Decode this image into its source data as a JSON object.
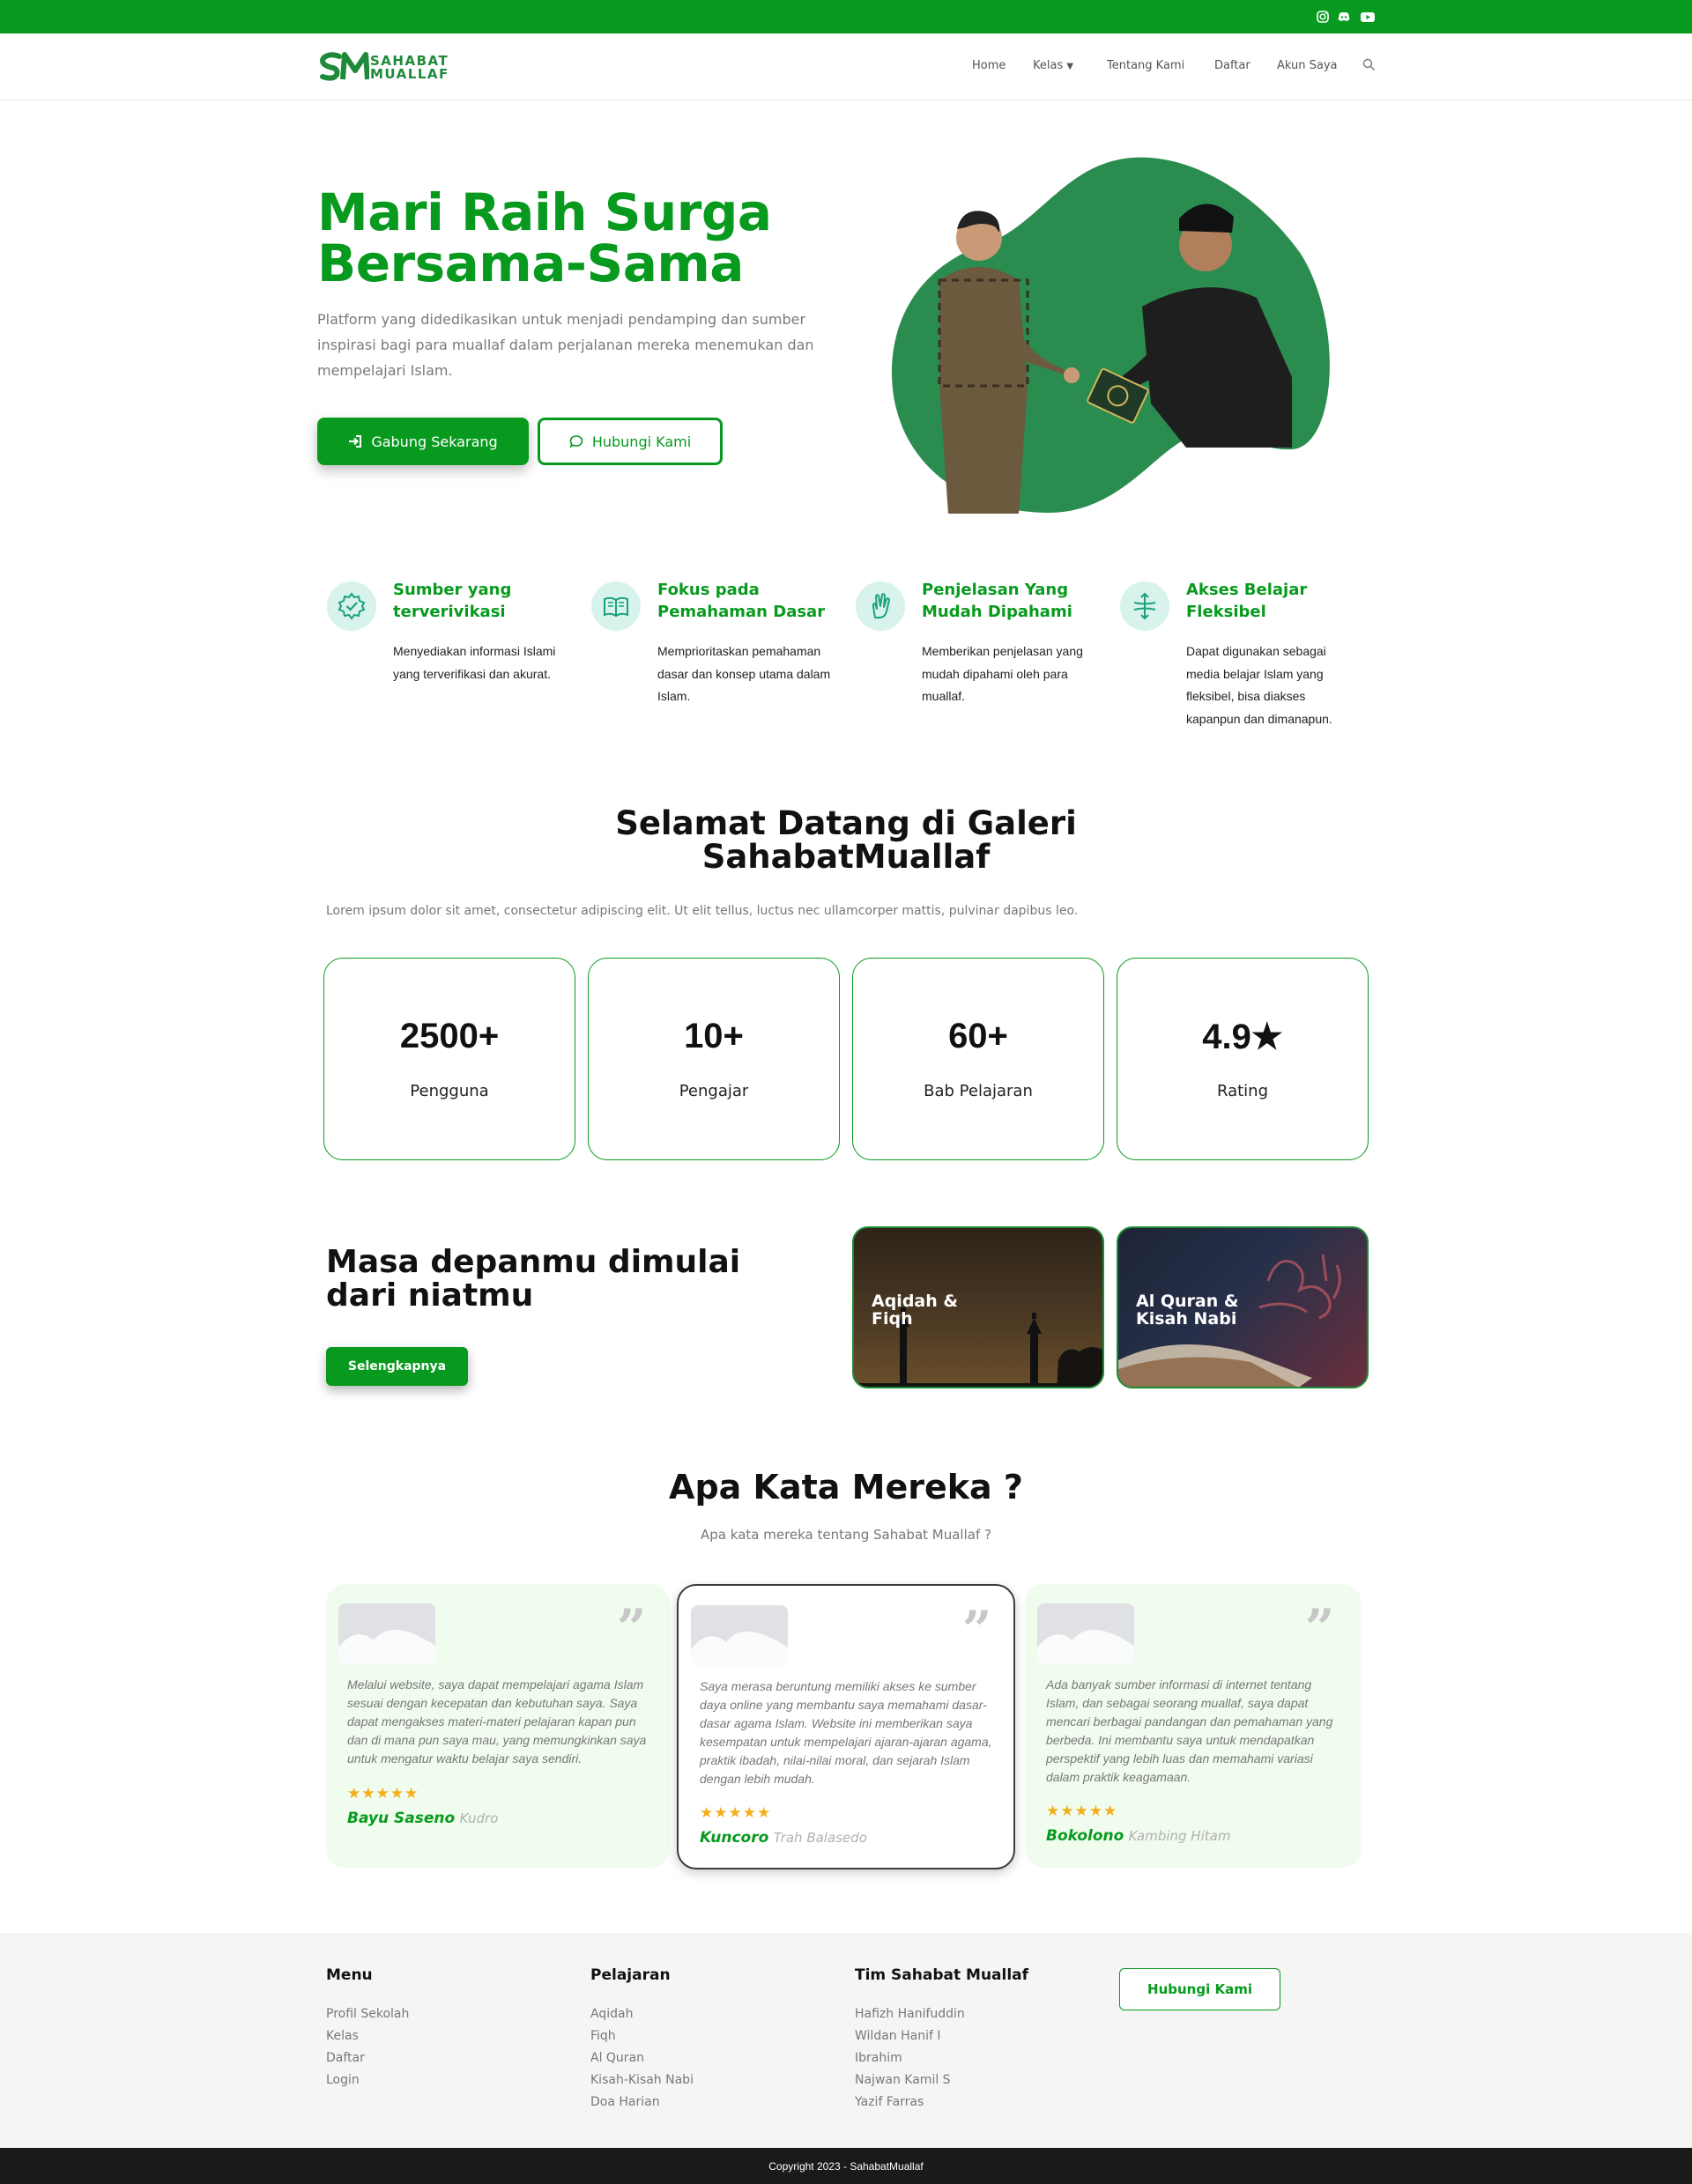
{
  "topbar": {
    "background": "#089a1e",
    "social_icons": [
      "instagram-icon",
      "discord-icon",
      "youtube-icon"
    ]
  },
  "nav": {
    "logo_mark": "SM",
    "logo_line1": "SAHABAT",
    "logo_line2": "MUALLAF",
    "items": [
      {
        "label": "Home"
      },
      {
        "label": "Kelas"
      },
      {
        "label": "Tentang Kami"
      },
      {
        "label": "Daftar"
      },
      {
        "label": "Akun Saya"
      }
    ],
    "search_icon": "search-icon"
  },
  "hero": {
    "title_line1": "Mari Raih Surga",
    "title_line2": "Bersama-Sama",
    "description": "Platform yang didedikasikan untuk menjadi pendamping dan sumber inspirasi bagi para muallaf dalam perjalanan mereka menemukan dan mempelajari Islam.",
    "primary_button": "Gabung Sekarang",
    "secondary_button": "Hubungi Kami"
  },
  "features": [
    {
      "title": "Sumber yang terverivikasi",
      "description": "Menyediakan informasi Islami yang terverifikasi dan akurat.",
      "icon": "verified-badge-icon"
    },
    {
      "title": "Fokus pada Pemahaman Dasar",
      "description": "Memprioritaskan pemahaman dasar dan konsep utama dalam Islam.",
      "icon": "open-book-icon"
    },
    {
      "title": "Penjelasan Yang Mudah Dipahami",
      "description": "Memberikan penjelasan yang mudah dipahami oleh para muallaf.",
      "icon": "hand-gesture-icon"
    },
    {
      "title": "Akses Belajar Fleksibel",
      "description": "Dapat digunakan sebagai media belajar Islam yang fleksibel, bisa diakses kapanpun dan dimanapun.",
      "icon": "flexible-arrows-icon"
    }
  ],
  "welcome": {
    "title_line1": "Selamat Datang di Galeri",
    "title_line2": "SahabatMuallaf",
    "lorem": "Lorem ipsum dolor sit amet, consectetur adipiscing elit. Ut elit tellus, luctus nec ullamcorper mattis, pulvinar dapibus leo."
  },
  "stats": [
    {
      "value": "2500+",
      "label": "Pengguna"
    },
    {
      "value": "10+",
      "label": "Pengajar"
    },
    {
      "value": "60+",
      "label": "Bab Pelajaran"
    },
    {
      "value": "4.9★",
      "label": "Rating"
    }
  ],
  "future": {
    "title": "Masa depanmu dimulai dari niatmu",
    "button": "Selengkapnya",
    "courses": [
      {
        "label_line1": "Aqidah &",
        "label_line2": "Fiqh"
      },
      {
        "label_line1": "Al Quran &",
        "label_line2": "Kisah Nabi"
      }
    ]
  },
  "testimonials": {
    "title": "Apa Kata Mereka ?",
    "subtitle": "Apa kata mereka tentang Sahabat Muallaf ?",
    "items": [
      {
        "text": "Melalui website, saya dapat mempelajari agama Islam sesuai dengan kecepatan dan kebutuhan saya. Saya dapat mengakses materi-materi pelajaran kapan pun dan di mana pun saya mau, yang memungkinkan saya untuk mengatur waktu belajar saya sendiri.",
        "stars": "★★★★★",
        "rating": 5,
        "name": "Bayu Saseno",
        "role": "Kudro"
      },
      {
        "text": "Saya merasa beruntung memiliki akses ke sumber daya online yang membantu saya memahami dasar-dasar agama Islam. Website ini memberikan saya kesempatan untuk mempelajari ajaran-ajaran agama, praktik ibadah, nilai-nilai moral, dan sejarah Islam dengan lebih mudah.",
        "stars": "★★★★★",
        "rating": 5,
        "name": "Kuncoro",
        "role": "Trah Balasedo"
      },
      {
        "text": "Ada banyak sumber informasi di internet tentang Islam, dan sebagai seorang muallaf, saya dapat mencari berbagai pandangan dan pemahaman yang berbeda. Ini membantu saya untuk mendapatkan perspektif yang lebih luas dan memahami variasi dalam praktik keagamaan.",
        "stars": "★★★★★",
        "rating": 5,
        "name": "Bokolono",
        "role": "Kambing Hitam"
      }
    ]
  },
  "footer": {
    "menu": {
      "title": "Menu",
      "links": [
        "Profil Sekolah",
        "Kelas",
        "Daftar",
        "Login"
      ]
    },
    "pelajaran": {
      "title": "Pelajaran",
      "links": [
        "Aqidah",
        "Fiqh",
        "Al Quran",
        "Kisah-Kisah Nabi",
        "Doa Harian"
      ]
    },
    "tim": {
      "title": "Tim Sahabat Muallaf",
      "links": [
        "Hafizh Hanifuddin",
        "Wildan Hanif I",
        "Ibrahim",
        "Najwan Kamil S",
        "Yazif Farras"
      ]
    },
    "contact_button": "Hubungi Kami",
    "copyright": "Copyright 2023 - SahabatMuallaf"
  },
  "colors": {
    "primary": "#089a1e",
    "blob": "#2a8c4e",
    "footer_bg": "#f5f5f5",
    "copyright_bg": "#1a1a1a"
  }
}
